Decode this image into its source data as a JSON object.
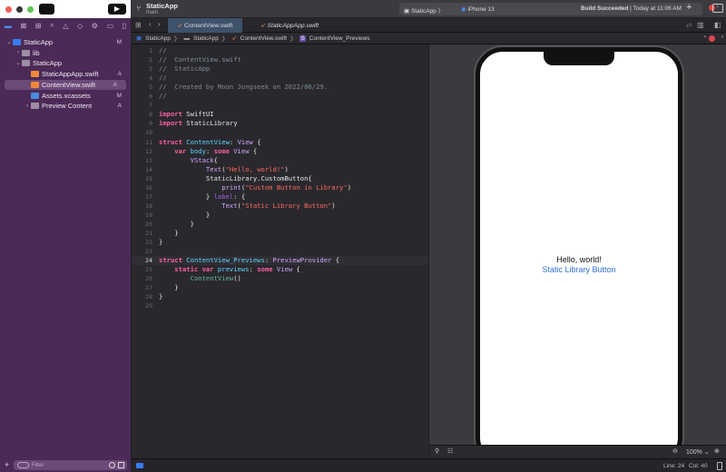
{
  "toolbar": {
    "project": "StaticApp",
    "branch": "main",
    "scheme": "StaticApp",
    "device": "iPhone 13",
    "build_status": "Build Succeeded",
    "build_time": "Today at 11:06 AM",
    "error_count": "1"
  },
  "tabs": [
    {
      "label": "ContentView.swift",
      "active": true
    },
    {
      "label": "StaticAppApp.swift",
      "active": false
    }
  ],
  "jumpbar": [
    "StaticApp",
    "StaticApp",
    "ContentView.swift",
    "ContentView_Previews"
  ],
  "navigator": [
    {
      "label": "StaticApp",
      "status": "M",
      "indent": 0,
      "disc": "⌄",
      "icon": "project",
      "color": "#3a7bf0"
    },
    {
      "label": "lib",
      "status": "",
      "indent": 1,
      "disc": "›",
      "icon": "folder",
      "color": "#9b8fa3"
    },
    {
      "label": "StaticApp",
      "status": "",
      "indent": 1,
      "disc": "⌄",
      "icon": "folder",
      "color": "#9b8fa3"
    },
    {
      "label": "StaticAppApp.swift",
      "status": "A",
      "indent": 2,
      "disc": "",
      "icon": "swift",
      "color": "#f0883a"
    },
    {
      "label": "ContentView.swift",
      "status": "A",
      "indent": 2,
      "disc": "",
      "icon": "swift",
      "color": "#f0883a",
      "selected": true
    },
    {
      "label": "Assets.xcassets",
      "status": "M",
      "indent": 2,
      "disc": "",
      "icon": "assets",
      "color": "#4a8ae0"
    },
    {
      "label": "Preview Content",
      "status": "A",
      "indent": 2,
      "disc": "›",
      "icon": "folder",
      "color": "#9b8fa3"
    }
  ],
  "filter_placeholder": "Filter",
  "code": [
    [
      [
        "//",
        "c"
      ]
    ],
    [
      [
        "//  ContentView.swift",
        "c"
      ]
    ],
    [
      [
        "//  StaticApp",
        "c"
      ]
    ],
    [
      [
        "//",
        "c"
      ]
    ],
    [
      [
        "//  Created by Moon Jongseek on 2022/06/29.",
        "c"
      ]
    ],
    [
      [
        "//",
        "c"
      ]
    ],
    [],
    [
      [
        "import",
        "k"
      ],
      [
        " SwiftUI",
        "p"
      ]
    ],
    [
      [
        "import",
        "k"
      ],
      [
        " StaticLibrary",
        "p"
      ]
    ],
    [],
    [
      [
        "struct",
        "k"
      ],
      [
        " ",
        "p"
      ],
      [
        "ContentView",
        "d"
      ],
      [
        ": ",
        "p"
      ],
      [
        "View",
        "t"
      ],
      [
        " {",
        "p"
      ]
    ],
    [
      [
        "    var",
        "k"
      ],
      [
        " ",
        "p"
      ],
      [
        "body",
        "d"
      ],
      [
        ": ",
        "p"
      ],
      [
        "some",
        "k"
      ],
      [
        " ",
        "p"
      ],
      [
        "View",
        "t"
      ],
      [
        " {",
        "p"
      ]
    ],
    [
      [
        "        VStack",
        "t"
      ],
      [
        "{",
        "p"
      ]
    ],
    [
      [
        "            Text",
        "t"
      ],
      [
        "(",
        "p"
      ],
      [
        "\"Hello, world!\"",
        "s"
      ],
      [
        ")",
        "p"
      ]
    ],
    [
      [
        "            StaticLibrary.CustomButton{",
        "p"
      ]
    ],
    [
      [
        "                print",
        "t"
      ],
      [
        "(",
        "p"
      ],
      [
        "\"Custom Button in Library\"",
        "s"
      ],
      [
        ")",
        "p"
      ]
    ],
    [
      [
        "            } ",
        "p"
      ],
      [
        "label",
        "m"
      ],
      [
        ": {",
        "p"
      ]
    ],
    [
      [
        "                Text",
        "t"
      ],
      [
        "(",
        "p"
      ],
      [
        "\"Static Library Button\"",
        "s"
      ],
      [
        ")",
        "p"
      ]
    ],
    [
      [
        "            }",
        "p"
      ]
    ],
    [
      [
        "        }",
        "p"
      ]
    ],
    [
      [
        "    }",
        "p"
      ]
    ],
    [
      [
        "}",
        "p"
      ]
    ],
    [],
    [
      [
        "struct",
        "k"
      ],
      [
        " ",
        "p"
      ],
      [
        "ContentView_Previews",
        "d"
      ],
      [
        ": ",
        "p"
      ],
      [
        "PreviewProvider",
        "t"
      ],
      [
        " {",
        "p"
      ]
    ],
    [
      [
        "    static",
        "k"
      ],
      [
        " ",
        "p"
      ],
      [
        "var",
        "k"
      ],
      [
        " ",
        "p"
      ],
      [
        "previews",
        "d"
      ],
      [
        ": ",
        "p"
      ],
      [
        "some",
        "k"
      ],
      [
        " ",
        "p"
      ],
      [
        "View",
        "t"
      ],
      [
        " {",
        "p"
      ]
    ],
    [
      [
        "        ContentView",
        "f"
      ],
      [
        "()",
        "p"
      ]
    ],
    [
      [
        "    }",
        "p"
      ]
    ],
    [
      [
        "}",
        "p"
      ]
    ],
    []
  ],
  "current_line": 24,
  "preview": {
    "text": "Hello, world!",
    "button": "Static Library Button",
    "zoom": "100%"
  },
  "cursor": {
    "line_label": "Line: 24",
    "col_label": "Col: 40"
  },
  "colors": {
    "sidebar": "#4b2a57",
    "accent": "#3a7bf0",
    "link": "#2f6fd8"
  }
}
